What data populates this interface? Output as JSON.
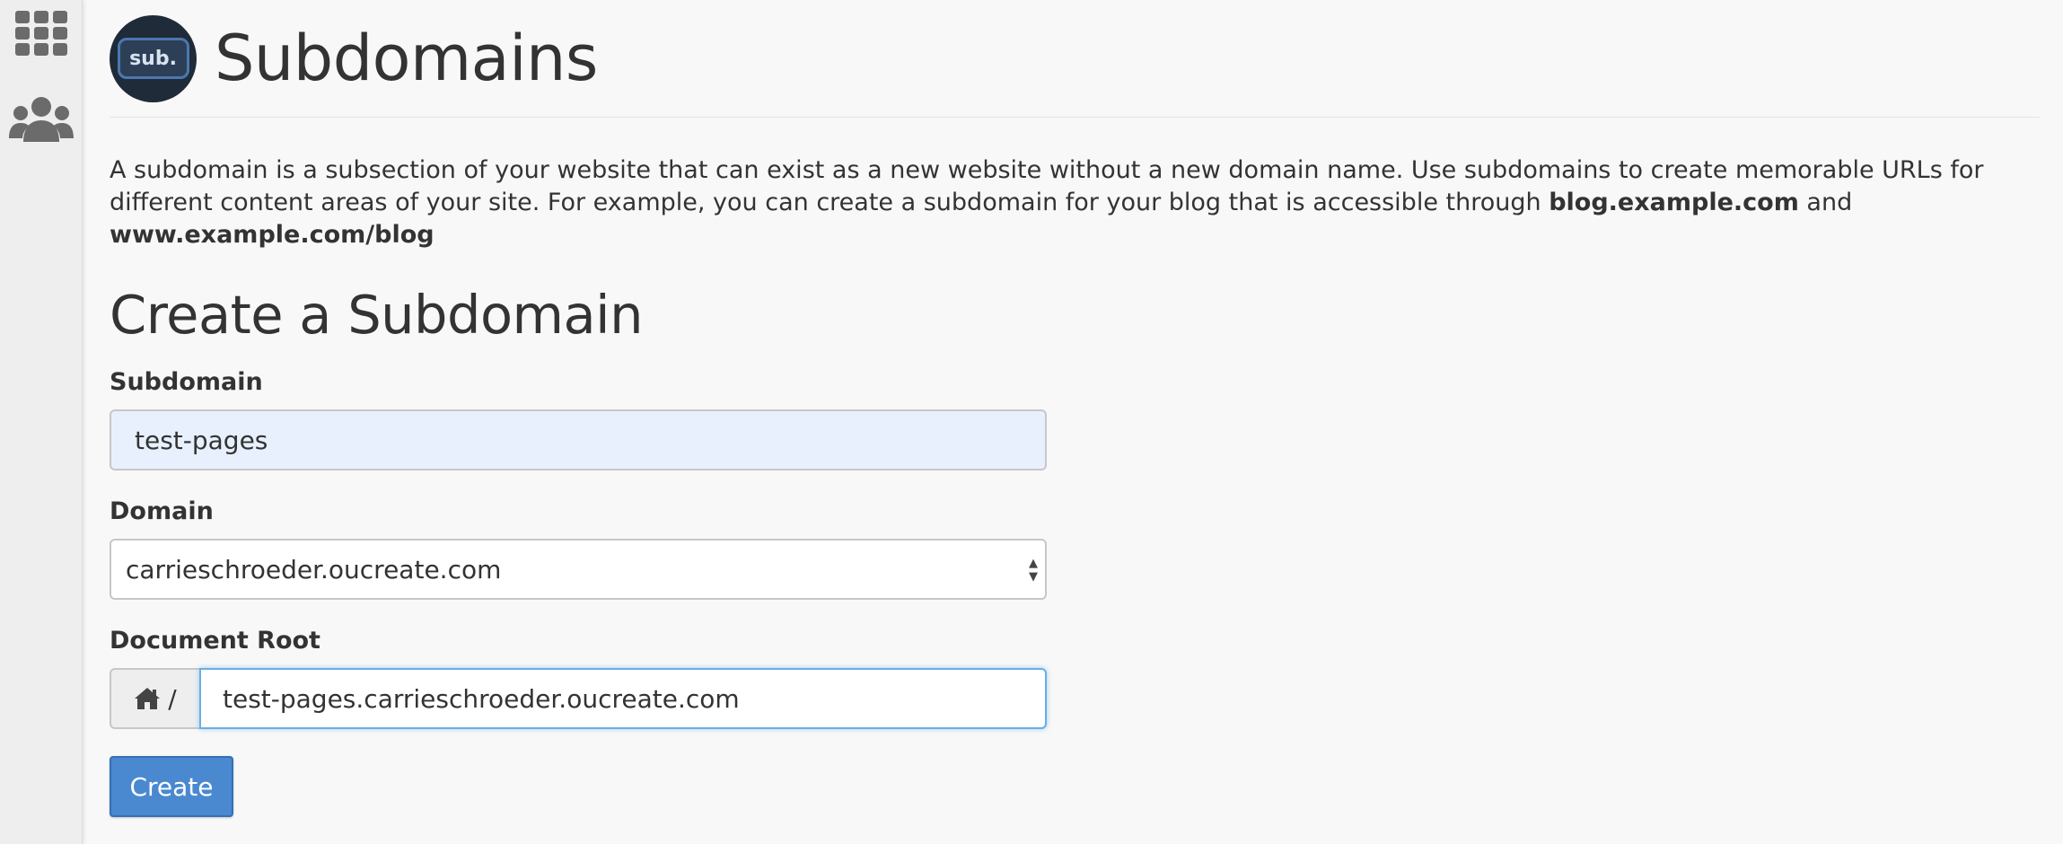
{
  "sidebar": {
    "icons": [
      {
        "name": "apps-grid-icon"
      },
      {
        "name": "users-icon"
      }
    ]
  },
  "header": {
    "logo_text": "sub.",
    "title": "Subdomains"
  },
  "description": {
    "text_1": "A subdomain is a subsection of your website that can exist as a new website without a new domain name. Use subdomains to create memorable URLs for different content areas of your site. For example, you can create a subdomain for your blog that is accessible through ",
    "example_1": "blog.example.com",
    "text_2": " and ",
    "example_2": "www.example.com/blog"
  },
  "form": {
    "section_title": "Create a Subdomain",
    "subdomain_label": "Subdomain",
    "subdomain_value": "test-pages",
    "domain_label": "Domain",
    "domain_selected": "carrieschroeder.oucreate.com",
    "document_root_label": "Document Root",
    "document_root_prefix": "/",
    "document_root_value": "test-pages.carrieschroeder.oucreate.com",
    "create_button": "Create"
  },
  "colors": {
    "primary_button": "#4a89d0",
    "autofill_bg": "#e8f0fe",
    "focus_border": "#66afe9",
    "logo_bg": "#1f2b38"
  }
}
